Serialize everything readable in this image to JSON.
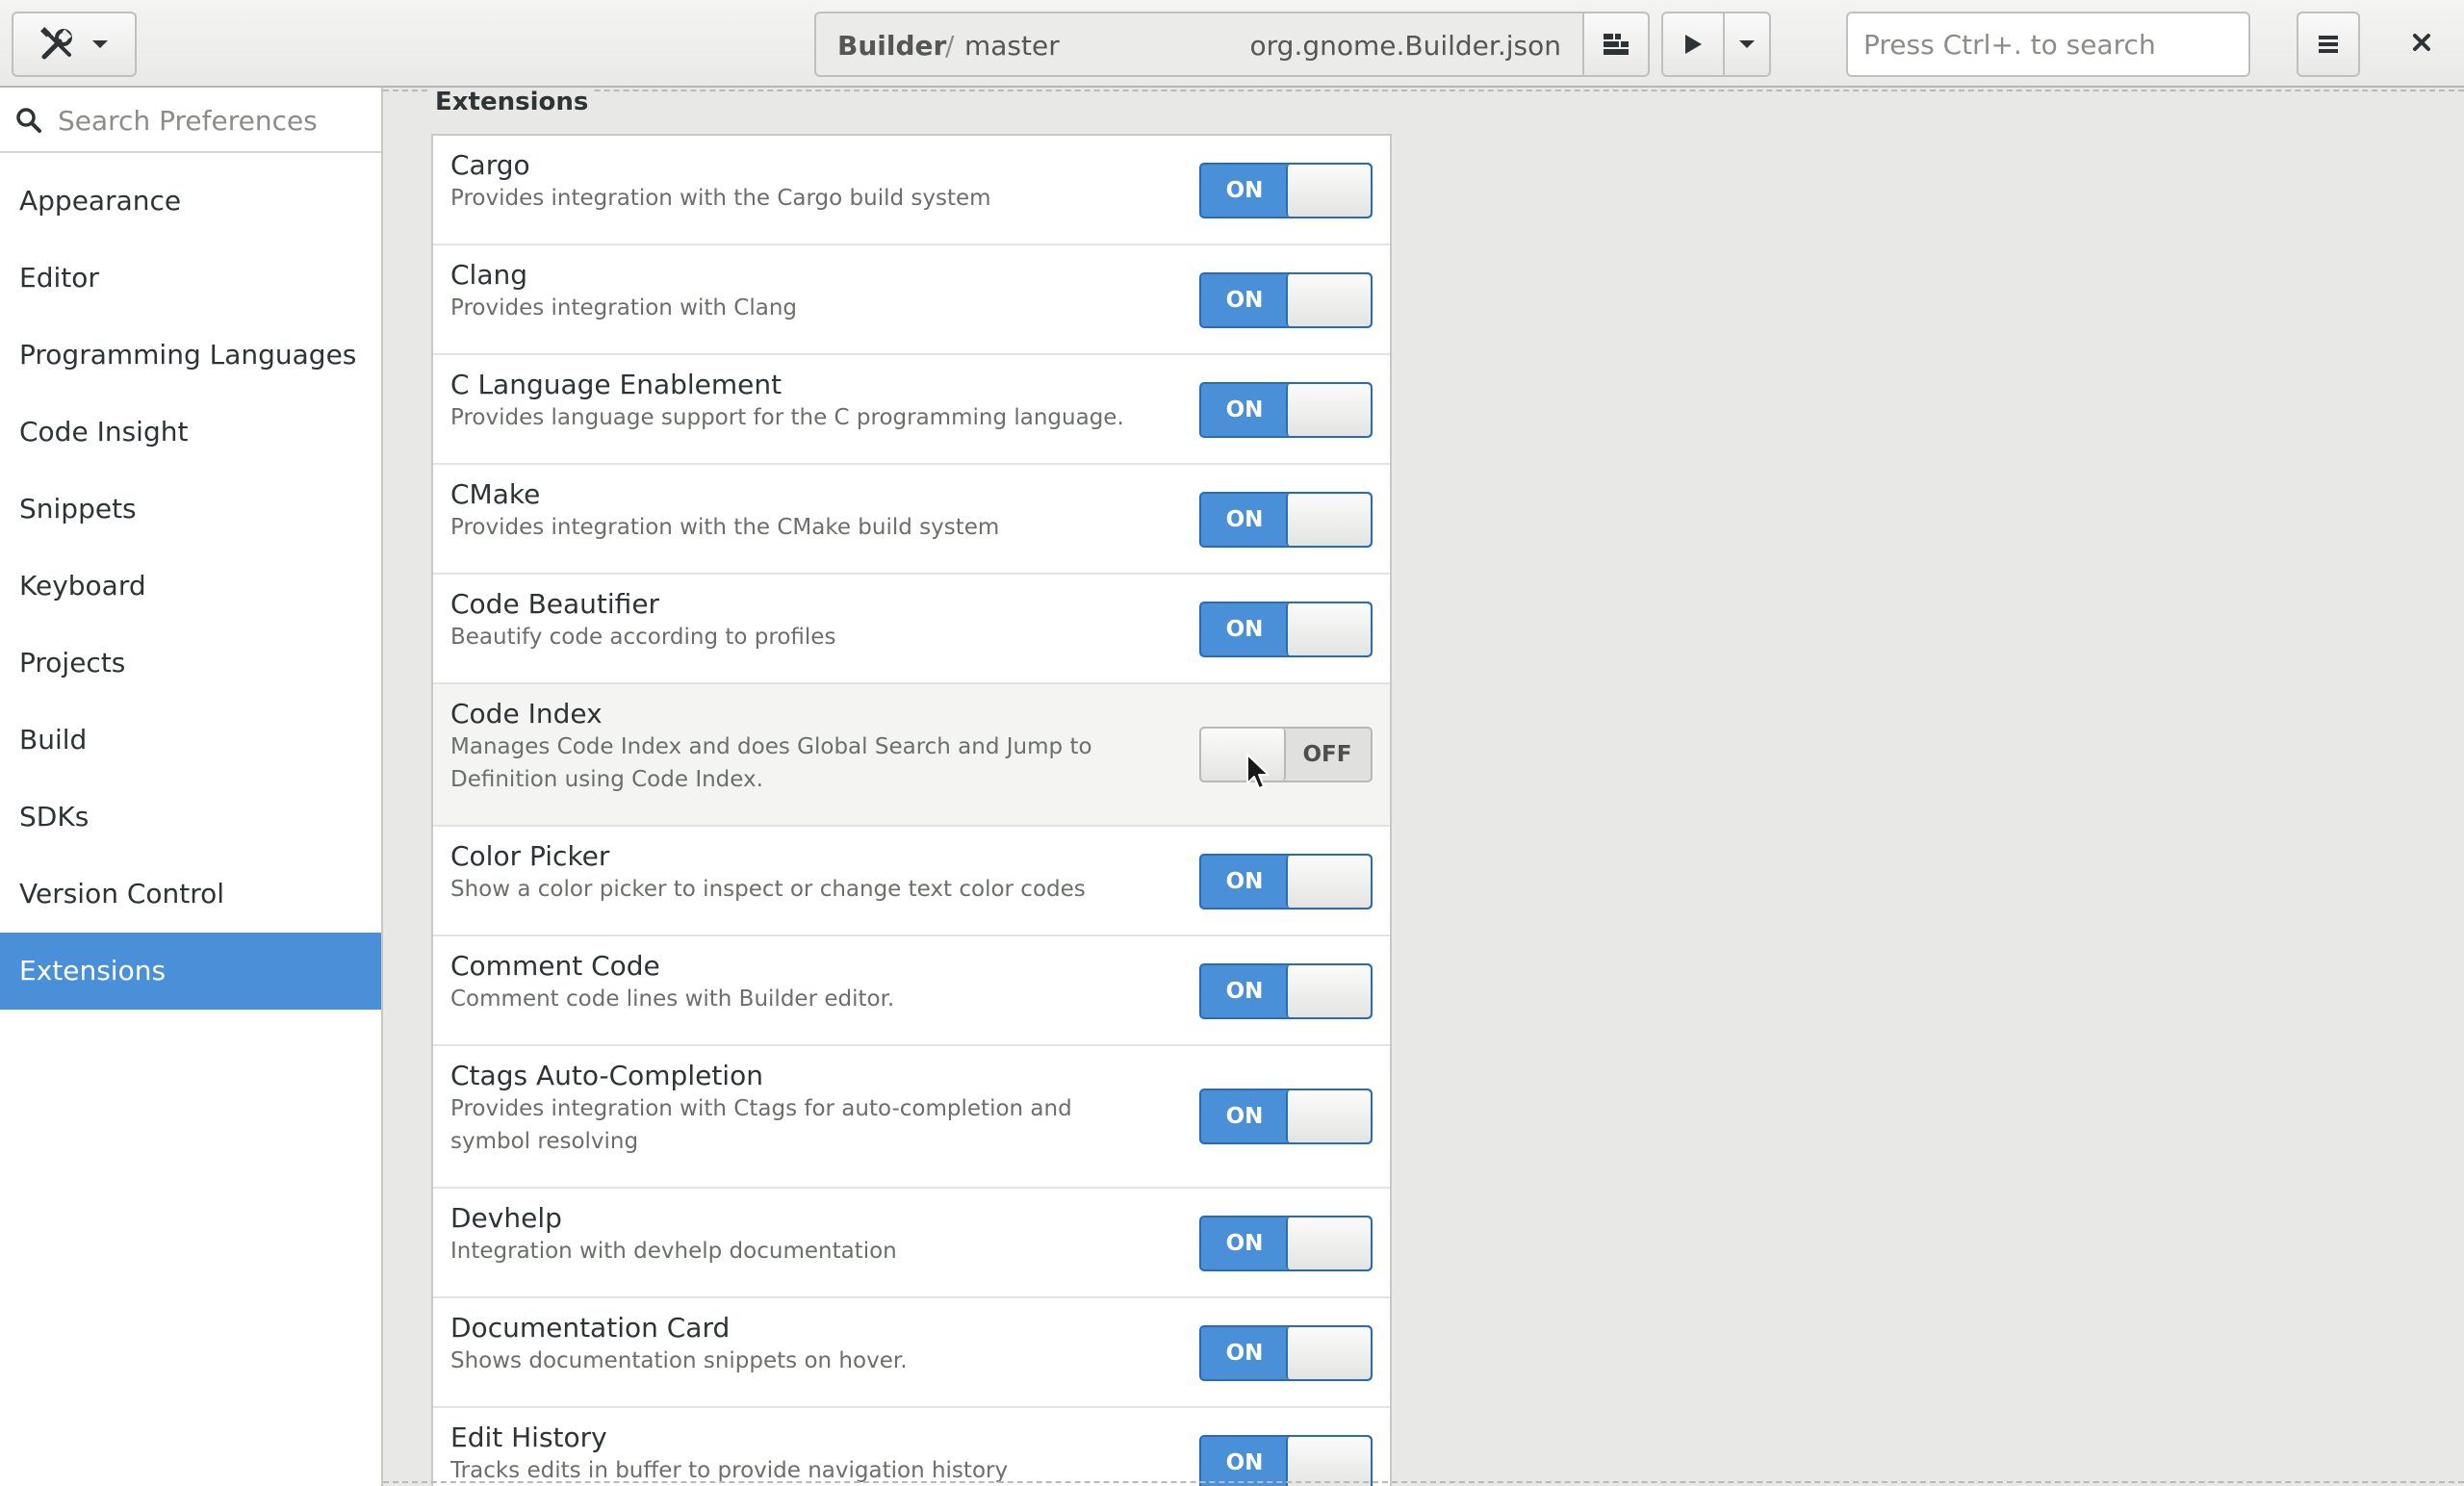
{
  "header": {
    "perspective_icon": "tools-icon",
    "dropdown_icon": "chevron-down-icon",
    "project": "Builder",
    "separator": "/",
    "branch": "master",
    "config": "org.gnome.Builder.json",
    "build_config_icon": "build-configuration-icon",
    "run_icon": "play-icon",
    "run_menu_icon": "chevron-down-icon",
    "search_placeholder": "Press Ctrl+. to search",
    "menu_icon": "hamburger-menu-icon",
    "close_icon": "close-icon"
  },
  "sidebar": {
    "search_placeholder": "Search Preferences",
    "items": [
      {
        "label": "Appearance"
      },
      {
        "label": "Editor"
      },
      {
        "label": "Programming Languages"
      },
      {
        "label": "Code Insight"
      },
      {
        "label": "Snippets"
      },
      {
        "label": "Keyboard"
      },
      {
        "label": "Projects"
      },
      {
        "label": "Build"
      },
      {
        "label": "SDKs"
      },
      {
        "label": "Version Control"
      },
      {
        "label": "Extensions"
      }
    ],
    "selected": "Extensions"
  },
  "main": {
    "section_title": "Extensions",
    "extensions": [
      {
        "name": "Cargo",
        "description": "Provides integration with the Cargo build system",
        "state": "ON"
      },
      {
        "name": "Clang",
        "description": "Provides integration with Clang",
        "state": "ON"
      },
      {
        "name": "C Language Enablement",
        "description": "Provides language support for the C programming language.",
        "state": "ON"
      },
      {
        "name": "CMake",
        "description": "Provides integration with the CMake build system",
        "state": "ON"
      },
      {
        "name": "Code Beautifier",
        "description": "Beautify code according to profiles",
        "state": "ON"
      },
      {
        "name": "Code Index",
        "description": "Manages Code Index and does Global Search and Jump to Definition using Code Index.",
        "state": "OFF"
      },
      {
        "name": "Color Picker",
        "description": "Show a color picker to inspect or change text color codes",
        "state": "ON"
      },
      {
        "name": "Comment Code",
        "description": "Comment code lines with Builder editor.",
        "state": "ON"
      },
      {
        "name": "Ctags Auto-Completion",
        "description": "Provides integration with Ctags for auto-completion and symbol resolving",
        "state": "ON"
      },
      {
        "name": "Devhelp",
        "description": "Integration with devhelp documentation",
        "state": "ON"
      },
      {
        "name": "Documentation Card",
        "description": "Shows documentation snippets on hover.",
        "state": "ON"
      },
      {
        "name": "Edit History",
        "description": "Tracks edits in buffer to provide navigation history",
        "state": "ON"
      }
    ]
  },
  "colors": {
    "accent": "#4a90d9",
    "switch_on_border": "#2a6bb5",
    "sidebar_selected_text": "#ffffff"
  }
}
